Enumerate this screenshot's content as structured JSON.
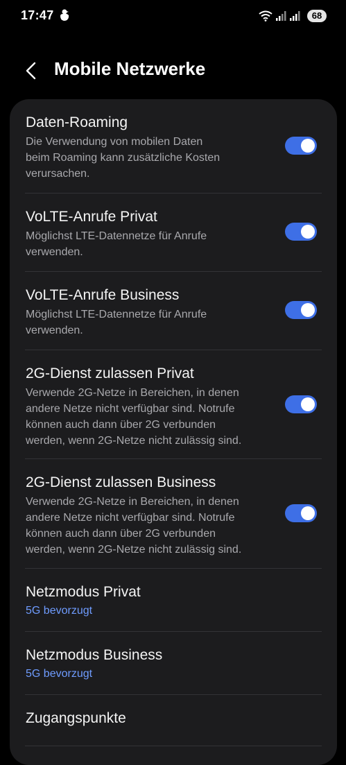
{
  "status_bar": {
    "time": "17:47",
    "battery": "68",
    "notification_icon": "duck-icon",
    "wifi_icon": "wifi-icon",
    "signal_icons": [
      "signal-1-icon",
      "signal-2-icon"
    ]
  },
  "header": {
    "back_icon": "chevron-left-icon",
    "title": "Mobile Netzwerke"
  },
  "settings": {
    "data_roaming": {
      "title": "Daten-Roaming",
      "desc_lines": [
        "Die Verwendung von mobilen Daten",
        "beim Roaming kann zusätzliche Kosten",
        "verursachen."
      ],
      "enabled": true
    },
    "volte_private": {
      "title": "VoLTE-Anrufe Privat",
      "desc_lines": [
        "Möglichst LTE-Datennetze für Anrufe",
        "verwenden."
      ],
      "enabled": true
    },
    "volte_business": {
      "title": "VoLTE-Anrufe Business",
      "desc_lines": [
        "Möglichst LTE-Datennetze für Anrufe",
        "verwenden."
      ],
      "enabled": true
    },
    "g2_private": {
      "title": "2G-Dienst zulassen Privat",
      "desc_lines": [
        "Verwende 2G-Netze in Bereichen, in denen",
        "andere Netze nicht verfügbar sind. Notrufe",
        "können auch dann über 2G verbunden",
        "werden, wenn 2G-Netze nicht zulässig sind."
      ],
      "enabled": true
    },
    "g2_business": {
      "title": "2G-Dienst zulassen Business",
      "desc_lines": [
        "Verwende 2G-Netze in Bereichen, in denen",
        "andere Netze nicht verfügbar sind. Notrufe",
        "können auch dann über 2G verbunden",
        "werden, wenn 2G-Netze nicht zulässig sind."
      ],
      "enabled": true
    },
    "network_mode_private": {
      "title": "Netzmodus Privat",
      "value": "5G bevorzugt"
    },
    "network_mode_business": {
      "title": "Netzmodus Business",
      "value": "5G bevorzugt"
    },
    "access_points": {
      "title": "Zugangspunkte"
    }
  },
  "colors": {
    "background": "#000000",
    "card": "#1c1c1e",
    "toggle_on": "#3e6fe6",
    "accent_value": "#6f9cff",
    "secondary_text": "#a9a9ad"
  }
}
